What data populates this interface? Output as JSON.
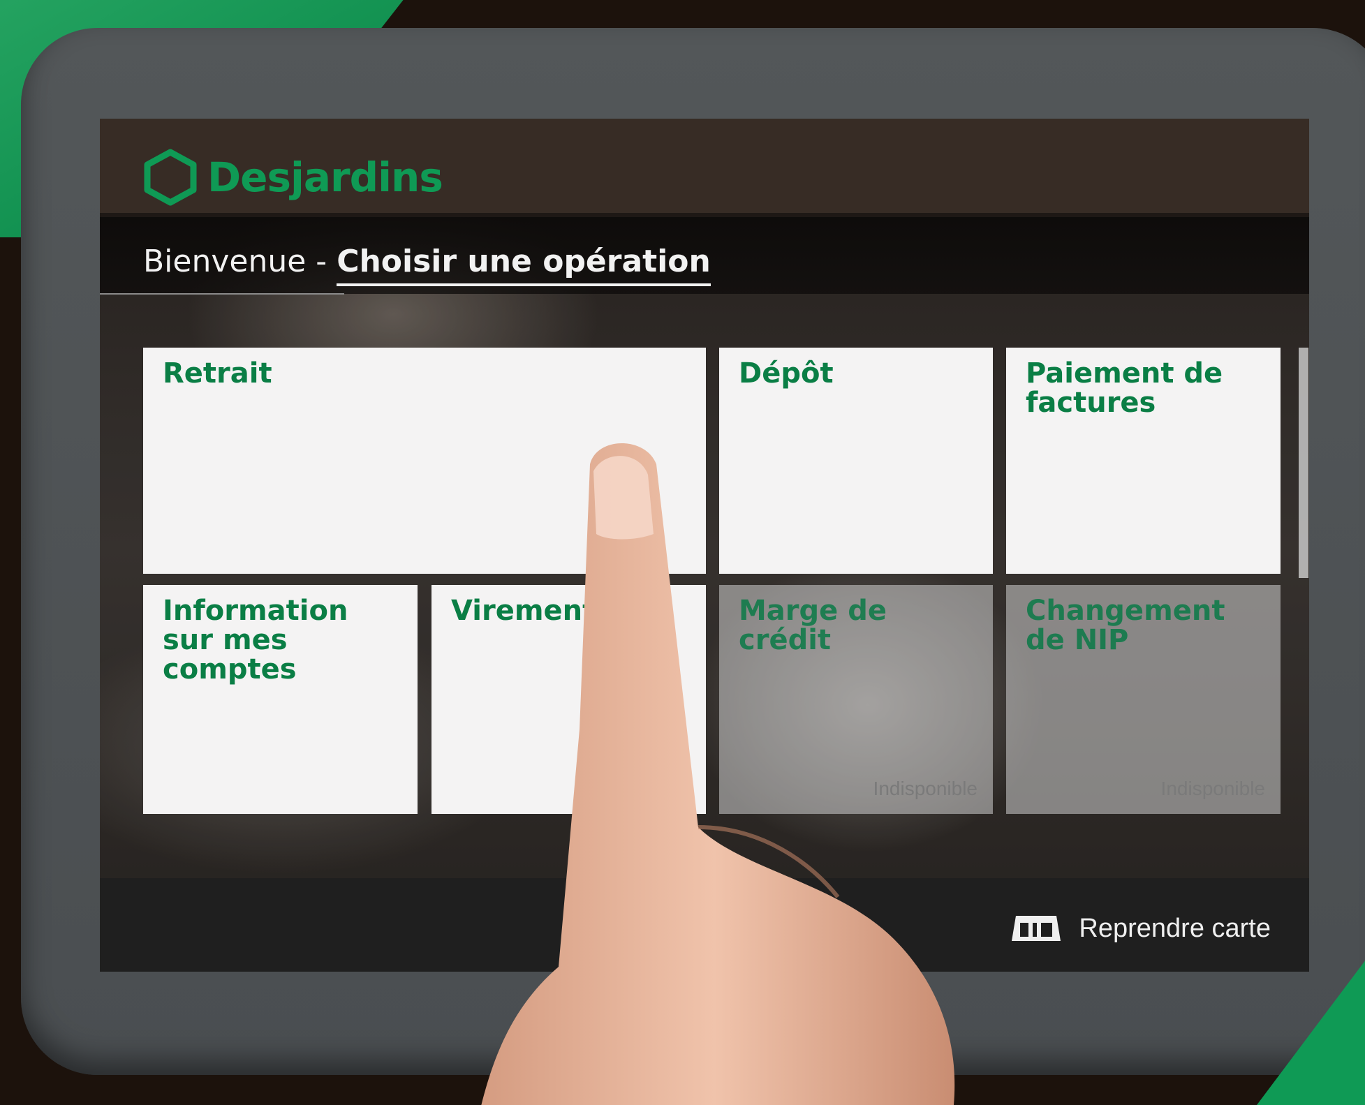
{
  "brand": {
    "name": "Desjardins",
    "color": "#0f9a55"
  },
  "header": {
    "greeting_prefix": "Bienvenue -",
    "greeting_active": "Choisir une opération"
  },
  "operations": [
    {
      "label": "Retrait",
      "status": ""
    },
    {
      "label": "Dépôt",
      "status": ""
    },
    {
      "label": "Paiement de factures",
      "status": ""
    },
    {
      "label": "Information sur mes comptes",
      "status": ""
    },
    {
      "label": "Virement",
      "status": ""
    },
    {
      "label": "Marge de crédit",
      "status": "Indisponible"
    },
    {
      "label": "Changement de NIP",
      "status": "Indisponible"
    }
  ],
  "footer": {
    "return_card_label": "Reprendre carte",
    "return_card_icon": "card-return-icon"
  },
  "colors": {
    "tile_text": "#0a7e45",
    "tile_bg": "#f4f3f3",
    "screen_bg": "#161311",
    "bezel": "#4e5254"
  }
}
